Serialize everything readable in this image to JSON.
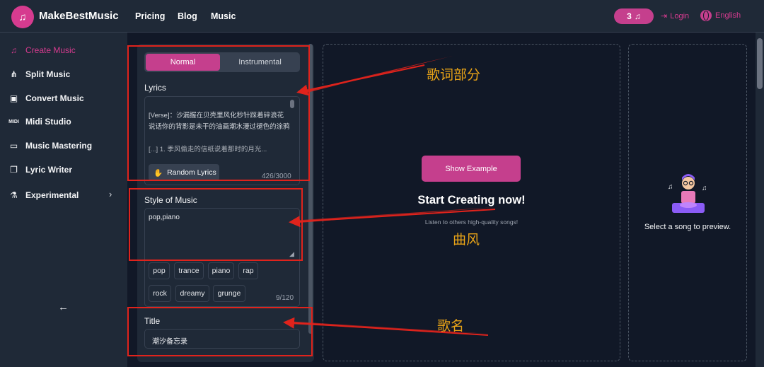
{
  "brand": {
    "name": "MakeBestMusic",
    "logo_icon": "music-note-icon"
  },
  "nav": {
    "pricing": "Pricing",
    "blog": "Blog",
    "music": "Music"
  },
  "header": {
    "credits": "3",
    "login": "Login",
    "language": "English"
  },
  "sidebar": {
    "items": [
      {
        "label": "Create Music",
        "icon": "music-note-icon"
      },
      {
        "label": "Split Music",
        "icon": "split-icon"
      },
      {
        "label": "Convert Music",
        "icon": "convert-icon"
      },
      {
        "label": "Midi Studio",
        "icon": "midi-icon"
      },
      {
        "label": "Music Mastering",
        "icon": "mastering-icon"
      },
      {
        "label": "Lyric Writer",
        "icon": "document-icon"
      },
      {
        "label": "Experimental",
        "icon": "flask-icon"
      }
    ]
  },
  "form": {
    "mode_normal": "Normal",
    "mode_instrumental": "Instrumental",
    "lyrics_label": "Lyrics",
    "lyrics_value": "[Verse]：沙漏握在贝壳里风化秒针踩着碎浪花说话你的背影是未干的油画潮水漫过褪色的涂鸦",
    "lyrics_next": "[...] 1. 季风偷走的信纸说着那时的月光...",
    "random_lyrics": "Random Lyrics",
    "lyrics_count": "426/3000",
    "style_label": "Style of Music",
    "style_value": "pop,piano",
    "tags": [
      "pop",
      "trance",
      "piano",
      "rap",
      "rock",
      "dreamy",
      "grunge"
    ],
    "style_count": "9/120",
    "title_label": "Title",
    "title_value": "潮汐备忘录"
  },
  "main": {
    "show_example": "Show Example",
    "start_title": "Start Creating now!",
    "start_sub": "Listen to others high-quality songs!"
  },
  "preview": {
    "text": "Select a song to preview."
  },
  "annotations": {
    "lyrics": "歌词部分",
    "style": "曲风",
    "title": "歌名"
  },
  "colors": {
    "accent": "#c53f8d",
    "annotation_red": "#e0231c",
    "annotation_text": "#e8a317"
  }
}
